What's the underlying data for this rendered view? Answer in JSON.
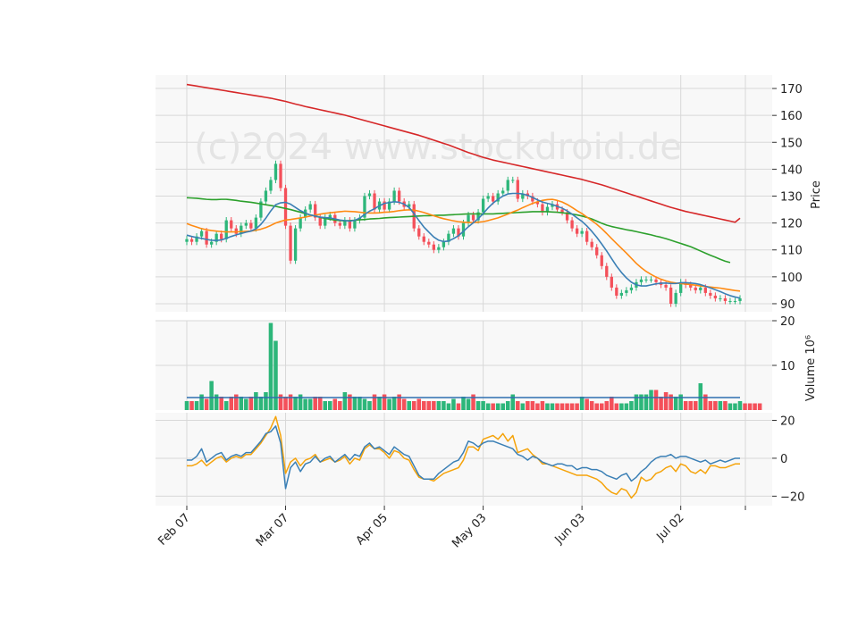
{
  "watermark": "(c)2024 www.stockdroid.de",
  "colors": {
    "up": "#2db67a",
    "down": "#f4505a",
    "sma_short": "#3a7fb5",
    "sma_mid": "#ff8a12",
    "sma_long": "#2ca02c",
    "sma_200": "#d62728",
    "volume_avg": "#2f6fb0",
    "macd": "#3a7fb5",
    "signal": "#f5a30a",
    "panel_bg": "#f8f8f8",
    "grid": "#d8d8d8"
  },
  "chart_data": [
    {
      "type": "candlestick",
      "panel": "price",
      "ylabel": "Price",
      "ylim": [
        87,
        175
      ],
      "yticks": [
        90,
        100,
        110,
        120,
        130,
        140,
        150,
        160,
        170
      ],
      "x_tick_labels": [
        "Feb 07",
        "Mar 07",
        "Apr 05",
        "May 03",
        "Jun 03",
        "Jul 02"
      ],
      "x_tick_index": [
        0,
        20,
        40,
        60,
        80,
        100
      ],
      "close": [
        114,
        113,
        115,
        117,
        112,
        113,
        116,
        114,
        121,
        118,
        116,
        119,
        120,
        118,
        122,
        128,
        132,
        136,
        142,
        133,
        119,
        106,
        118,
        122,
        125,
        127,
        122,
        119,
        122,
        123,
        120,
        119,
        121,
        118,
        121,
        122,
        130,
        131,
        125,
        128,
        125,
        128,
        132,
        128,
        126,
        127,
        118,
        115,
        113,
        112,
        110,
        111,
        113,
        116,
        118,
        115,
        120,
        123,
        121,
        124,
        129,
        130,
        128,
        131,
        132,
        136,
        136,
        129,
        131,
        130,
        128,
        127,
        124,
        126,
        127,
        125,
        124,
        121,
        118,
        116,
        117,
        113,
        111,
        108,
        104,
        100,
        96,
        93,
        94,
        95,
        96,
        98,
        99,
        99,
        99,
        98,
        97,
        96,
        90,
        94,
        98,
        97,
        96,
        95,
        96,
        94,
        93,
        92,
        92,
        91,
        91,
        91,
        92
      ],
      "ma_short": {
        "name": "",
        "values": [
          115.5,
          115.0,
          114.6,
          114.3,
          113.9,
          113.6,
          113.5,
          113.7,
          114.3,
          115.0,
          115.6,
          116.1,
          116.6,
          117.0,
          117.8,
          119.5,
          121.8,
          124.5,
          126.8,
          127.5,
          127.7,
          127.0,
          125.8,
          124.6,
          123.7,
          123.0,
          122.6,
          122.2,
          122.0,
          121.9,
          121.5,
          121.1,
          120.9,
          120.7,
          121.0,
          121.8,
          123.2,
          124.4,
          125.3,
          126.4,
          127.3,
          127.6,
          127.9,
          127.7,
          127.0,
          125.8,
          123.5,
          120.9,
          118.5,
          116.6,
          114.8,
          113.6,
          113.1,
          113.3,
          114.2,
          115.3,
          116.9,
          118.6,
          120.1,
          121.6,
          123.5,
          125.6,
          127.4,
          128.8,
          130.0,
          130.8,
          131.0,
          131.0,
          130.8,
          130.3,
          129.5,
          128.6,
          127.8,
          127.3,
          126.9,
          126.2,
          125.5,
          124.5,
          123.3,
          121.9,
          120.6,
          118.9,
          116.9,
          114.7,
          112.2,
          109.6,
          106.8,
          104.0,
          101.6,
          99.6,
          98.0,
          97.0,
          96.6,
          96.6,
          97.0,
          97.4,
          97.6,
          97.7,
          97.5,
          97.5,
          97.8,
          97.8,
          97.7,
          97.5,
          97.1,
          96.5,
          95.9,
          95.2,
          94.5,
          93.7,
          93.0,
          92.5,
          92.1
        ]
      },
      "ma_mid": {
        "name": "",
        "values": [
          119.8,
          119.1,
          118.5,
          117.9,
          117.5,
          117.2,
          117.0,
          116.8,
          116.7,
          116.7,
          116.7,
          116.8,
          116.9,
          117.0,
          117.3,
          117.7,
          118.3,
          119.1,
          120.0,
          120.6,
          121.1,
          121.3,
          121.6,
          121.9,
          122.2,
          122.6,
          122.9,
          123.3,
          123.6,
          123.8,
          124.0,
          124.2,
          124.4,
          124.3,
          124.2,
          124.0,
          123.8,
          123.7,
          123.7,
          123.8,
          124.0,
          124.1,
          124.3,
          124.6,
          124.8,
          124.9,
          124.8,
          124.4,
          123.9,
          123.3,
          122.7,
          122.1,
          121.6,
          121.2,
          120.8,
          120.5,
          120.3,
          120.2,
          120.2,
          120.3,
          120.5,
          120.9,
          121.4,
          121.9,
          122.6,
          123.3,
          124.1,
          124.8,
          125.7,
          126.5,
          127.3,
          127.9,
          128.4,
          128.7,
          128.8,
          128.4,
          127.8,
          126.9,
          125.8,
          124.6,
          123.5,
          122.2,
          120.9,
          119.5,
          117.9,
          116.1,
          114.2,
          112.4,
          110.6,
          108.8,
          106.9,
          105.0,
          103.4,
          102.0,
          100.9,
          99.9,
          99.1,
          98.5,
          98.0,
          97.7,
          97.5,
          97.3,
          97.1,
          96.9,
          96.6,
          96.4,
          96.2,
          96.0,
          95.8,
          95.5,
          95.2,
          94.9,
          94.7
        ]
      },
      "ma_long": {
        "name": "",
        "values": [
          129.4,
          129.3,
          129.2,
          129.0,
          128.8,
          128.7,
          128.7,
          128.8,
          128.8,
          128.6,
          128.4,
          128.1,
          127.9,
          127.7,
          127.4,
          127.1,
          126.8,
          126.5,
          126.2,
          125.8,
          125.4,
          125.0,
          124.5,
          124.0,
          123.5,
          123.0,
          122.6,
          122.1,
          121.7,
          121.4,
          121.1,
          120.9,
          120.8,
          120.9,
          121.0,
          121.2,
          121.3,
          121.5,
          121.6,
          121.7,
          121.9,
          122.0,
          122.1,
          122.2,
          122.3,
          122.4,
          122.5,
          122.6,
          122.7,
          122.7,
          122.8,
          122.9,
          122.9,
          123.0,
          123.1,
          123.2,
          123.3,
          123.4,
          123.4,
          123.4,
          123.4,
          123.4,
          123.4,
          123.5,
          123.6,
          123.7,
          123.8,
          123.9,
          124.0,
          124.1,
          124.2,
          124.2,
          124.2,
          124.2,
          124.1,
          124.0,
          123.8,
          123.6,
          123.3,
          123.0,
          122.6,
          122.1,
          121.5,
          120.7,
          119.9,
          119.2,
          118.7,
          118.3,
          117.9,
          117.5,
          117.2,
          116.8,
          116.4,
          116.0,
          115.6,
          115.1,
          114.7,
          114.2,
          113.6,
          113.0,
          112.4,
          111.8,
          111.2,
          110.4,
          109.6,
          108.8,
          108.0,
          107.3,
          106.5,
          105.8,
          105.3
        ]
      },
      "ma_200": {
        "name": "",
        "values": [
          171.5,
          171.2,
          170.9,
          170.6,
          170.3,
          170.0,
          169.7,
          169.4,
          169.1,
          168.8,
          168.5,
          168.2,
          167.9,
          167.6,
          167.3,
          167.0,
          166.7,
          166.4,
          166.0,
          165.6,
          165.2,
          164.7,
          164.2,
          163.8,
          163.3,
          162.9,
          162.5,
          162.1,
          161.7,
          161.3,
          160.9,
          160.5,
          160.1,
          159.6,
          159.1,
          158.6,
          158.1,
          157.6,
          157.1,
          156.6,
          156.1,
          155.6,
          155.1,
          154.6,
          154.1,
          153.6,
          153.1,
          152.6,
          152.0,
          151.4,
          150.8,
          150.2,
          149.6,
          149.0,
          148.3,
          147.6,
          146.9,
          146.2,
          145.6,
          145.0,
          144.4,
          143.9,
          143.4,
          143.0,
          142.6,
          142.2,
          141.8,
          141.4,
          141.0,
          140.6,
          140.2,
          139.8,
          139.4,
          139.0,
          138.6,
          138.2,
          137.8,
          137.4,
          137.0,
          136.6,
          136.2,
          135.7,
          135.2,
          134.7,
          134.2,
          133.6,
          133.0,
          132.4,
          131.8,
          131.2,
          130.6,
          130.0,
          129.4,
          128.8,
          128.2,
          127.6,
          127.0,
          126.4,
          125.8,
          125.3,
          124.8,
          124.3,
          123.9,
          123.5,
          123.1,
          122.7,
          122.3,
          121.9,
          121.5,
          121.1,
          120.7,
          120.3,
          121.8
        ]
      }
    },
    {
      "type": "bar",
      "panel": "volume",
      "ylabel": "Volume",
      "multiplier": "10⁶",
      "ylim": [
        0,
        20
      ],
      "yticks": [
        10,
        20
      ],
      "values": [
        2,
        2,
        2,
        3.5,
        2.5,
        6.5,
        3.5,
        3,
        2,
        3,
        3.5,
        3,
        2.5,
        3,
        4,
        3,
        4,
        19.5,
        15.5,
        3.5,
        3,
        3.5,
        3,
        3.5,
        2.5,
        2.5,
        3,
        3,
        2,
        2,
        2.5,
        2,
        4,
        3.5,
        3,
        3,
        2.5,
        2,
        3.5,
        3,
        3.5,
        2.5,
        3,
        3.5,
        2.5,
        2,
        2,
        2.5,
        2,
        2,
        2,
        2,
        2,
        1.5,
        2.5,
        1.5,
        3,
        2.5,
        3.5,
        2,
        2,
        1.5,
        1.5,
        1.5,
        1.5,
        2,
        3.5,
        2,
        1.5,
        2,
        2,
        1.5,
        2,
        1.5,
        1.5,
        1.5,
        1.5,
        1.5,
        1.5,
        1.5,
        3,
        2.5,
        2,
        1.5,
        1.5,
        2,
        3,
        1.5,
        1.5,
        1.5,
        2,
        3.5,
        3.5,
        3.5,
        4.5,
        4.5,
        3,
        4,
        3.5,
        3,
        3.5,
        2,
        2,
        2,
        6,
        3.5,
        2,
        2,
        2,
        2,
        1.5,
        1.5,
        2,
        1.5,
        1.5,
        1.5,
        1.5
      ],
      "average": 2.8
    },
    {
      "type": "line",
      "panel": "oscillator",
      "ylim": [
        -25,
        24
      ],
      "yticks": [
        -20,
        0,
        20
      ],
      "series": [
        {
          "name": "",
          "values": [
            -1,
            -1,
            1,
            5,
            -2,
            0,
            2,
            3,
            -1,
            1,
            2,
            1,
            3,
            3,
            6,
            9,
            13,
            14,
            17,
            8,
            -16,
            -5,
            -2,
            -7,
            -3,
            -2,
            1,
            -2,
            0,
            1,
            -2,
            0,
            2,
            -1,
            2,
            1,
            6,
            8,
            5,
            6,
            4,
            2,
            6,
            4,
            2,
            1,
            -4,
            -9,
            -11,
            -11,
            -11,
            -8,
            -6,
            -4,
            -2,
            -1,
            3,
            9,
            8,
            6,
            8,
            9,
            9,
            8,
            7,
            6,
            5,
            2,
            1,
            -1,
            1,
            0,
            -2,
            -3,
            -4,
            -3,
            -3,
            -4,
            -4,
            -6,
            -5,
            -5,
            -6,
            -6,
            -7,
            -9,
            -10,
            -11,
            -9,
            -8,
            -12,
            -10,
            -7,
            -5,
            -2,
            0,
            1,
            1,
            2,
            0,
            1,
            1,
            0,
            -1,
            -2,
            -1,
            -3,
            -2,
            -1,
            -2,
            -1,
            0,
            0
          ]
        },
        {
          "name": "",
          "values": [
            -4,
            -4,
            -3,
            -1,
            -4,
            -2,
            0,
            1,
            -2,
            0,
            1,
            0,
            2,
            2,
            5,
            8,
            12,
            16,
            22,
            12,
            -8,
            -2,
            0,
            -4,
            -1,
            0,
            2,
            -2,
            -1,
            0,
            -2,
            -1,
            1,
            -3,
            0,
            -1,
            5,
            7,
            5,
            5,
            3,
            0,
            4,
            3,
            0,
            -1,
            -6,
            -10,
            -11,
            -11,
            -12,
            -10,
            -8,
            -7,
            -6,
            -5,
            -1,
            6,
            6,
            4,
            10,
            11,
            12,
            10,
            13,
            9,
            12,
            3,
            4,
            5,
            2,
            0,
            -3,
            -3,
            -4,
            -5,
            -6,
            -7,
            -8,
            -9,
            -9,
            -9,
            -10,
            -11,
            -13,
            -16,
            -18,
            -19,
            -16,
            -17,
            -21,
            -18,
            -10,
            -12,
            -11,
            -8,
            -7,
            -5,
            -4,
            -7,
            -3,
            -4,
            -7,
            -8,
            -6,
            -8,
            -4,
            -4,
            -5,
            -5,
            -4,
            -3,
            -3
          ]
        }
      ]
    }
  ]
}
